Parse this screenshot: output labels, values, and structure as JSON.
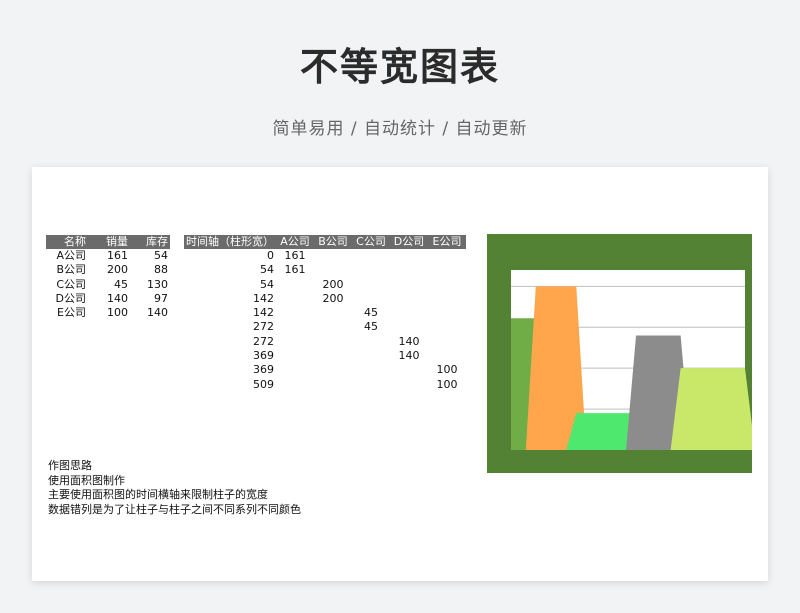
{
  "header": {
    "title": "不等宽图表",
    "subtitle": "简单易用 / 自动统计 / 自动更新"
  },
  "table1": {
    "headers": [
      "名称",
      "销量",
      "库存"
    ],
    "rows": [
      [
        "A公司",
        "161",
        "54"
      ],
      [
        "B公司",
        "200",
        "88"
      ],
      [
        "C公司",
        "45",
        "130"
      ],
      [
        "D公司",
        "140",
        "97"
      ],
      [
        "E公司",
        "100",
        "140"
      ]
    ]
  },
  "table2": {
    "headers": [
      "时间轴（柱形宽）",
      "A公司",
      "B公司",
      "C公司",
      "D公司",
      "E公司"
    ],
    "rows": [
      [
        "0",
        "161",
        "",
        "",
        "",
        ""
      ],
      [
        "54",
        "161",
        "",
        "",
        "",
        ""
      ],
      [
        "54",
        "",
        "200",
        "",
        "",
        ""
      ],
      [
        "142",
        "",
        "200",
        "",
        "",
        ""
      ],
      [
        "142",
        "",
        "",
        "45",
        "",
        ""
      ],
      [
        "272",
        "",
        "",
        "45",
        "",
        ""
      ],
      [
        "272",
        "",
        "",
        "",
        "140",
        ""
      ],
      [
        "369",
        "",
        "",
        "",
        "140",
        ""
      ],
      [
        "369",
        "",
        "",
        "",
        "",
        "100"
      ],
      [
        "509",
        "",
        "",
        "",
        "",
        "100"
      ]
    ]
  },
  "notes": {
    "lines": [
      "作图思路",
      "使用面积图制作",
      "主要使用面积图的时间横轴来限制柱子的宽度",
      "数据错列是为了让柱子与柱子之间不同系列不同颜色"
    ]
  },
  "chart_data": {
    "type": "area",
    "ylim": [
      0,
      220
    ],
    "grid": true,
    "legend": "none",
    "series": [
      {
        "name": "A公司",
        "color": "#70ad47",
        "x": [
          0,
          54
        ],
        "y": [
          161,
          161
        ]
      },
      {
        "name": "B公司",
        "color": "#ffa64d",
        "x": [
          54,
          142
        ],
        "y": [
          200,
          200
        ]
      },
      {
        "name": "C公司",
        "color": "#4ee86e",
        "x": [
          142,
          272
        ],
        "y": [
          45,
          45
        ]
      },
      {
        "name": "D公司",
        "color": "#8c8c8c",
        "x": [
          272,
          369
        ],
        "y": [
          140,
          140
        ]
      },
      {
        "name": "E公司",
        "color": "#c9e86a",
        "x": [
          369,
          509
        ],
        "y": [
          100,
          100
        ]
      }
    ],
    "colors": {
      "chart_bg": "#548235",
      "plot_bg": "#ffffff",
      "gridline": "#bfbfbf"
    }
  }
}
